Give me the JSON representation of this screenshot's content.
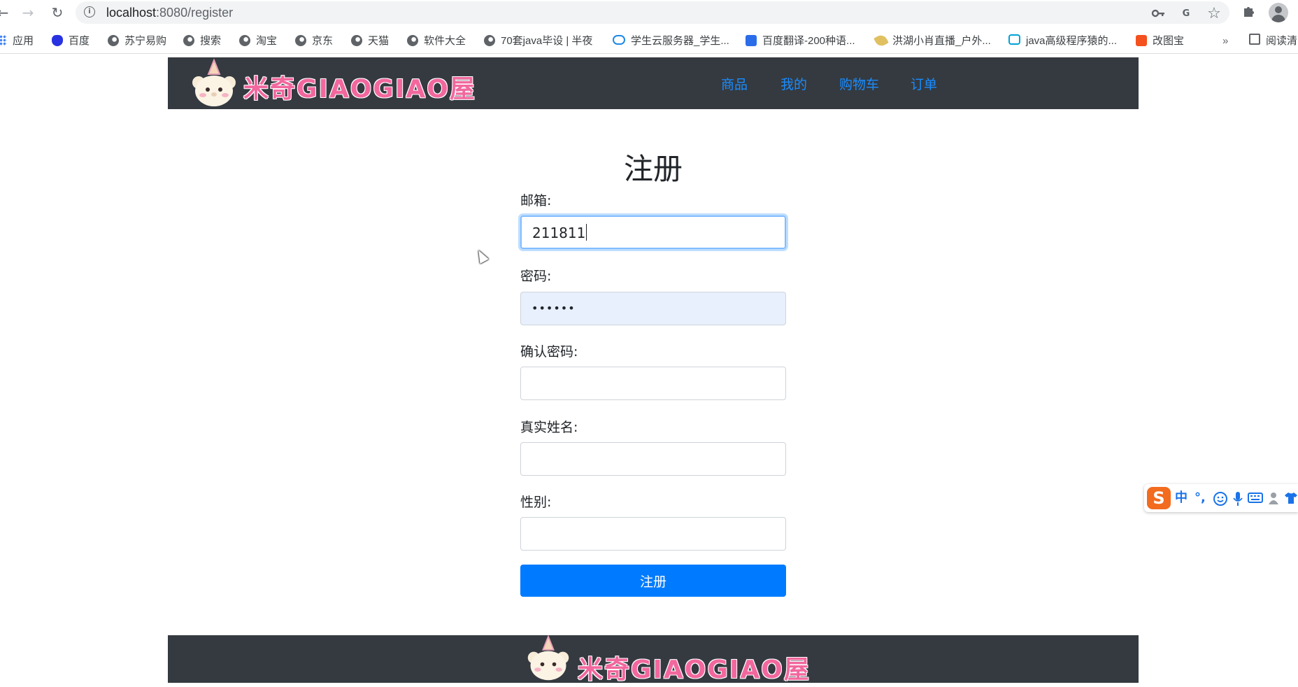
{
  "browser": {
    "url_host": "localhost",
    "url_path": ":8080/register",
    "bookmarks": [
      {
        "label": "应用",
        "icon": "apps-grid-icon"
      },
      {
        "label": "百度",
        "icon": "baidu-paw-icon"
      },
      {
        "label": "苏宁易购",
        "icon": "globe-icon"
      },
      {
        "label": "搜索",
        "icon": "globe-icon"
      },
      {
        "label": "淘宝",
        "icon": "globe-icon"
      },
      {
        "label": "京东",
        "icon": "globe-icon"
      },
      {
        "label": "天猫",
        "icon": "globe-icon"
      },
      {
        "label": "软件大全",
        "icon": "globe-icon"
      },
      {
        "label": "70套java毕设 | 半夜",
        "icon": "globe-icon"
      },
      {
        "label": "学生云服务器_学生...",
        "icon": "cloud-icon"
      },
      {
        "label": "百度翻译-200种语...",
        "icon": "baidu-translate-icon"
      },
      {
        "label": "洪湖小肖直播_户外...",
        "icon": "feather-icon"
      },
      {
        "label": "java高级程序猿的...",
        "icon": "bilibili-icon"
      },
      {
        "label": "改图宝",
        "icon": "gaitubao-icon"
      },
      {
        "label": "阅读清",
        "icon": "reading-list-icon"
      }
    ],
    "more_bookmarks": "»",
    "translate_glyph": "G"
  },
  "header": {
    "logo_text": "米奇GIAOGIAO屋",
    "nav": [
      "商品",
      "我的",
      "购物车",
      "订单"
    ]
  },
  "form": {
    "title": "注册",
    "email_label": "邮箱:",
    "email_value": "211811",
    "password_label": "密码:",
    "password_value": "••••••",
    "confirm_label": "确认密码:",
    "confirm_value": "",
    "realname_label": "真实姓名:",
    "realname_value": "",
    "gender_label": "性别:",
    "gender_value": "",
    "submit_label": "注册"
  },
  "footer": {
    "logo_text": "米奇GIAOGIAO屋"
  },
  "ime": {
    "logo": "S",
    "mode": "中",
    "punct": "°,"
  },
  "colors": {
    "header_bg": "#343a40",
    "nav_link": "#1a8cff",
    "primary": "#007bff",
    "autofill_bg": "#e8f0fe",
    "logo_pink": "#f2679e"
  }
}
